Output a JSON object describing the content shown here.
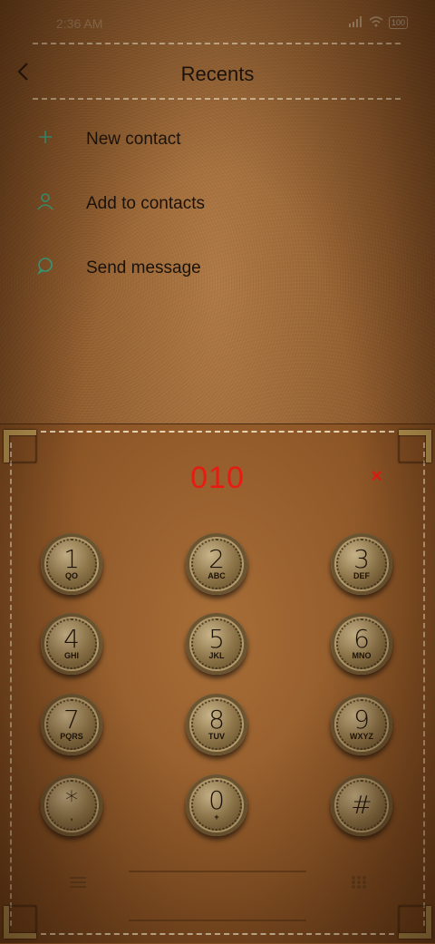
{
  "status": {
    "time": "2:36 AM",
    "battery": "100"
  },
  "header": {
    "title": "Recents"
  },
  "menu": [
    {
      "label": "New contact",
      "icon": "plus-icon"
    },
    {
      "label": "Add to contacts",
      "icon": "person-icon"
    },
    {
      "label": "Send message",
      "icon": "chat-bubble-icon"
    }
  ],
  "dialer": {
    "number": "010",
    "clear_symbol": "×",
    "keys": [
      {
        "digit": "1",
        "sub": "QO"
      },
      {
        "digit": "2",
        "sub": "ABC"
      },
      {
        "digit": "3",
        "sub": "DEF"
      },
      {
        "digit": "4",
        "sub": "GHI"
      },
      {
        "digit": "5",
        "sub": "JKL"
      },
      {
        "digit": "6",
        "sub": "MNO"
      },
      {
        "digit": "7",
        "sub": "PQRS"
      },
      {
        "digit": "8",
        "sub": "TUV"
      },
      {
        "digit": "9",
        "sub": "WXYZ"
      },
      {
        "digit": "*",
        "sub": ","
      },
      {
        "digit": "0",
        "sub": "+"
      },
      {
        "digit": "#",
        "sub": ""
      }
    ]
  },
  "colors": {
    "accent": "#e81b12",
    "icon_green": "#3bb08a",
    "text": "#1a120a"
  }
}
